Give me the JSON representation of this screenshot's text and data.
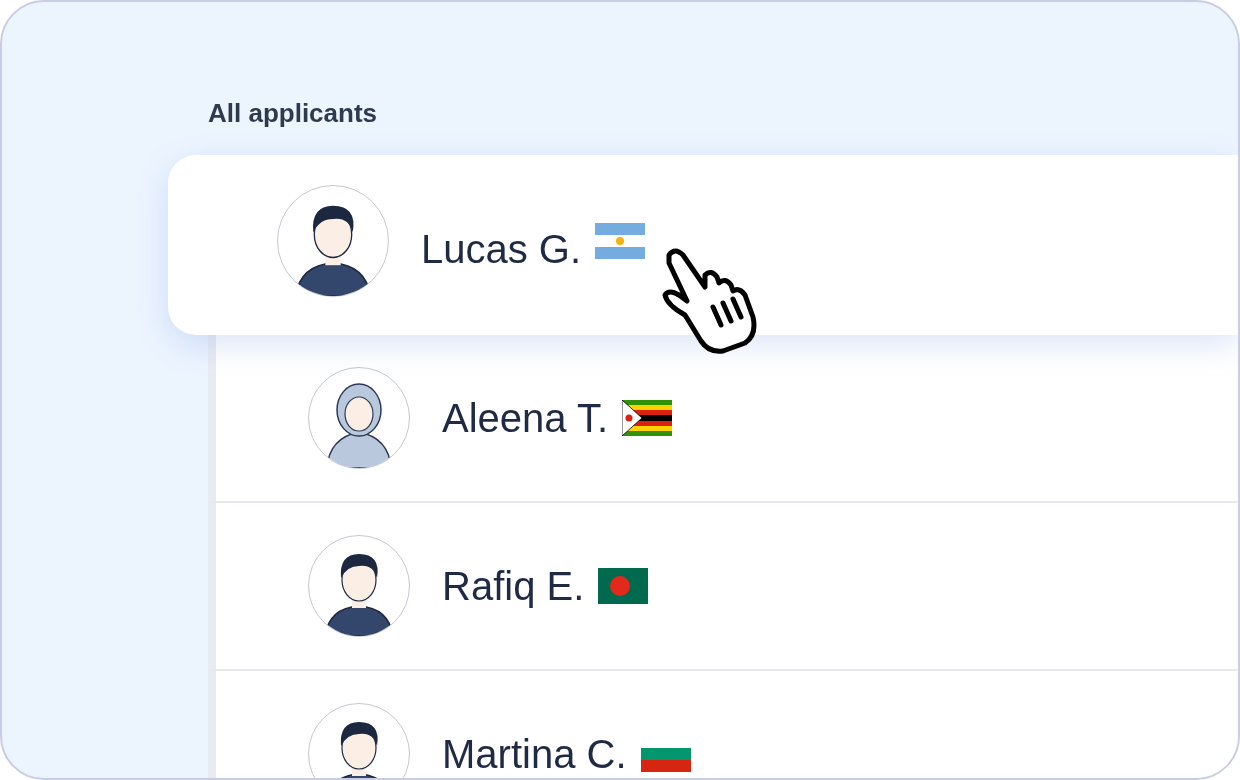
{
  "section_title": "All applicants",
  "applicants": [
    {
      "name": "Lucas G.",
      "flag": {
        "kind": "argentina"
      },
      "avatar": {
        "kind": "man"
      },
      "selected": true
    },
    {
      "name": "Aleena T.",
      "flag": {
        "kind": "zimbabwe"
      },
      "avatar": {
        "kind": "hijab"
      },
      "selected": false
    },
    {
      "name": "Rafiq E.",
      "flag": {
        "kind": "bangladesh"
      },
      "avatar": {
        "kind": "man"
      },
      "selected": false
    },
    {
      "name": "Martina C.",
      "flag": {
        "kind": "bulgaria"
      },
      "avatar": {
        "kind": "man"
      },
      "selected": false
    }
  ]
}
